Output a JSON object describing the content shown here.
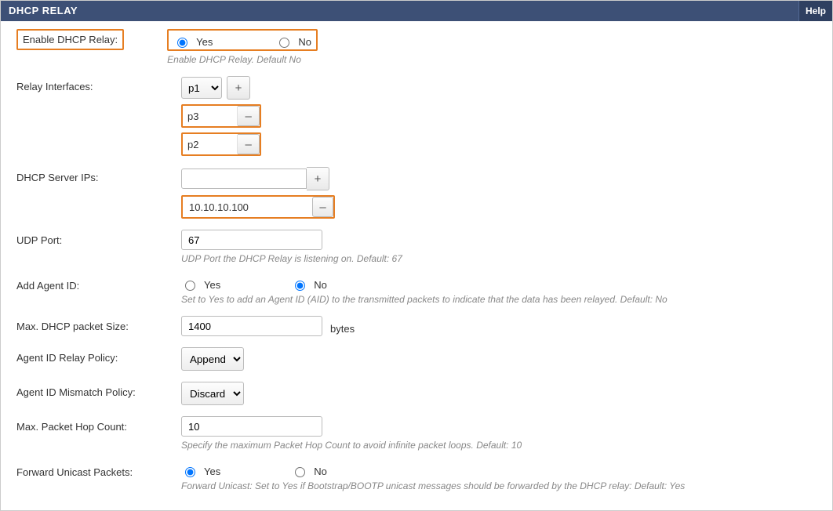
{
  "header": {
    "title": "DHCP RELAY",
    "help": "Help"
  },
  "enable": {
    "label": "Enable DHCP Relay:",
    "yes": "Yes",
    "no": "No",
    "hint": "Enable DHCP Relay. Default No"
  },
  "interfaces": {
    "label": "Relay Interfaces:",
    "select_value": "p1",
    "items": [
      "p3",
      "p2"
    ]
  },
  "server_ips": {
    "label": "DHCP Server IPs:",
    "input_value": "",
    "items": [
      "10.10.10.100"
    ]
  },
  "udp_port": {
    "label": "UDP Port:",
    "value": "67",
    "hint": "UDP Port the DHCP Relay is listening on. Default: 67"
  },
  "agent_id": {
    "label": "Add Agent ID:",
    "yes": "Yes",
    "no": "No",
    "hint": "Set to Yes to add an Agent ID (AID) to the transmitted packets to indicate that the data has been relayed. Default: No"
  },
  "packet_size": {
    "label": "Max. DHCP packet Size:",
    "value": "1400",
    "unit": "bytes"
  },
  "relay_policy": {
    "label": "Agent ID Relay Policy:",
    "value": "Append"
  },
  "mismatch_policy": {
    "label": "Agent ID Mismatch Policy:",
    "value": "Discard"
  },
  "hop_count": {
    "label": "Max. Packet Hop Count:",
    "value": "10",
    "hint": "Specify the maximum Packet Hop Count to avoid infinite packet loops. Default: 10"
  },
  "forward_unicast": {
    "label": "Forward Unicast Packets:",
    "yes": "Yes",
    "no": "No",
    "hint": "Forward Unicast: Set to Yes if Bootstrap/BOOTP unicast messages should be forwarded by the DHCP relay: Default: Yes"
  }
}
